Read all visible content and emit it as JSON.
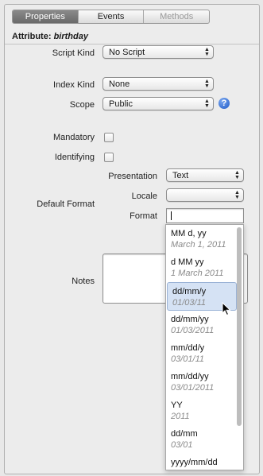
{
  "tabs": [
    {
      "label": "Properties",
      "state": "active"
    },
    {
      "label": "Events",
      "state": "normal"
    },
    {
      "label": "Methods",
      "state": "disabled"
    }
  ],
  "attribute": {
    "prefix": "Attribute:",
    "name": "birthday"
  },
  "fields": {
    "script_kind": {
      "label": "Script Kind",
      "value": "No Script"
    },
    "index_kind": {
      "label": "Index Kind",
      "value": "None"
    },
    "scope": {
      "label": "Scope",
      "value": "Public"
    },
    "mandatory": {
      "label": "Mandatory",
      "checked": false
    },
    "identifying": {
      "label": "Identifying",
      "checked": false
    },
    "default_format": {
      "label": "Default Format",
      "presentation": {
        "label": "Presentation",
        "value": "Text"
      },
      "locale": {
        "label": "Locale",
        "value": ""
      },
      "format": {
        "label": "Format",
        "value": ""
      }
    },
    "notes": {
      "label": "Notes",
      "value": ""
    }
  },
  "help_icon": "?",
  "format_options": [
    {
      "fmt": "MM d, yy",
      "example": "March 1, 2011"
    },
    {
      "fmt": "d MM yy",
      "example": "1 March 2011"
    },
    {
      "fmt": "dd/mm/y",
      "example": "01/03/11",
      "selected": true
    },
    {
      "fmt": "dd/mm/yy",
      "example": "01/03/2011"
    },
    {
      "fmt": "mm/dd/y",
      "example": "03/01/11"
    },
    {
      "fmt": "mm/dd/yy",
      "example": "03/01/2011"
    },
    {
      "fmt": "YY",
      "example": "2011"
    },
    {
      "fmt": "dd/mm",
      "example": "03/01"
    },
    {
      "fmt": "yyyy/mm/dd",
      "example": ""
    }
  ],
  "colors": {
    "accent": "#1f5bc9",
    "selection": "#d5e2f4"
  }
}
